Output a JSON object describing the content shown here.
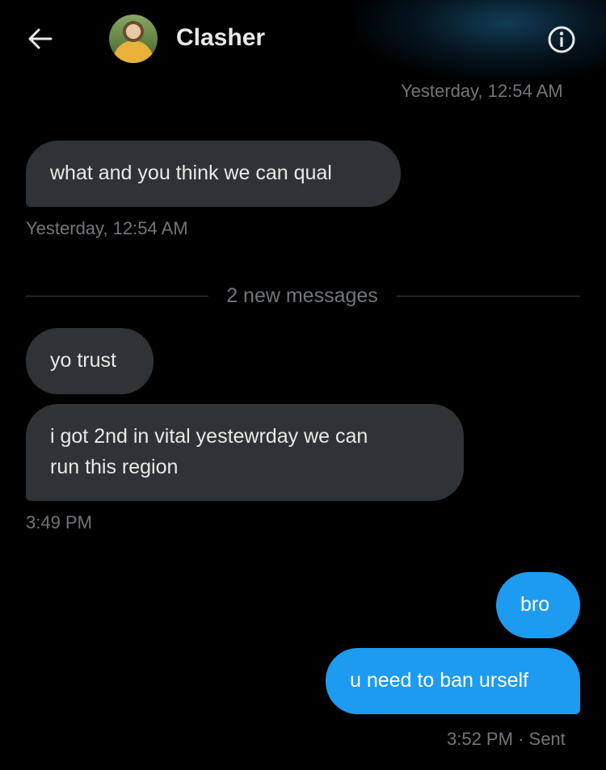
{
  "header": {
    "contact_name": "Clasher",
    "back_icon": "arrow-left-icon",
    "info_icon": "info-circle-icon"
  },
  "messages": {
    "top_timestamp": "Yesterday, 12:54 AM",
    "m1_text": "what and you think we can qual",
    "m1_timestamp": "Yesterday, 12:54 AM",
    "divider_label": "2 new messages",
    "m2_text": "yo trust",
    "m3_line1": "i got 2nd in vital yestewrday we can",
    "m3_line2": "run this region",
    "m3_timestamp": "3:49 PM",
    "m4_text": "bro",
    "m5_text": "u need to ban urself",
    "sent_time": "3:52 PM",
    "sent_sep": "·",
    "sent_status": "Sent"
  },
  "colors": {
    "background": "#000000",
    "incoming_bubble": "#2f3336",
    "outgoing_bubble": "#1d9bf0",
    "meta_text": "#71767b"
  }
}
